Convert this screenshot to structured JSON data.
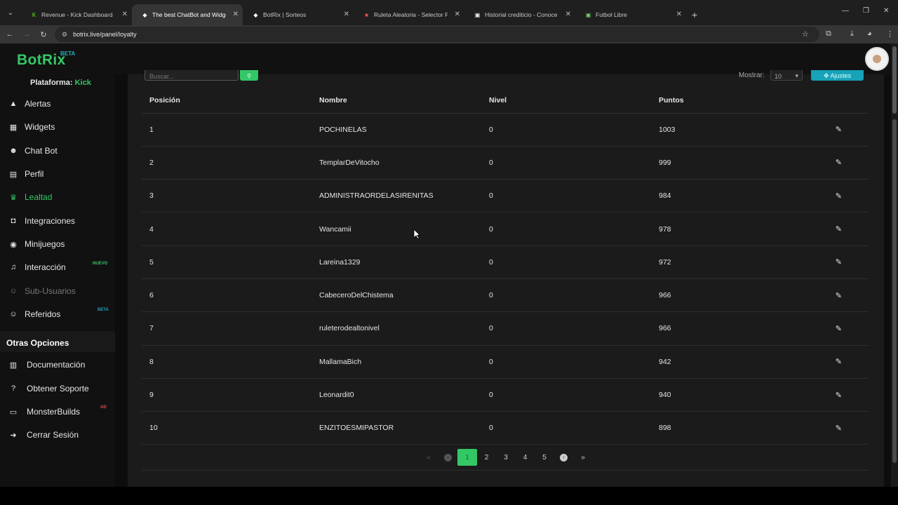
{
  "browser": {
    "tabs": [
      {
        "label": "Revenue - Kick Dashboard",
        "favicon_color": "#53fc18",
        "favicon_glyph": "K"
      },
      {
        "label": "The best ChatBot and Widgets",
        "favicon_color": "#ffffff",
        "favicon_glyph": "◆"
      },
      {
        "label": "BotRix | Sorteos",
        "favicon_color": "#ffffff",
        "favicon_glyph": "◆"
      },
      {
        "label": "Ruleta Aleatoria - Selector Pers",
        "favicon_color": "#e84b4b",
        "favicon_glyph": "■"
      },
      {
        "label": "Historial crediticio - Conoce tu",
        "favicon_color": "#ffffff",
        "favicon_glyph": "▣"
      },
      {
        "label": "Futbol Libre",
        "favicon_color": "#7bd17b",
        "favicon_glyph": "▣"
      }
    ],
    "active_tab_index": 1,
    "url": "botrix.live/panel/loyalty"
  },
  "app": {
    "logo": "BotRix",
    "logo_badge": "BETA",
    "platform_label": "Plataforma:",
    "platform_value": "Kick"
  },
  "sidebar": {
    "items": [
      {
        "label": "Alertas",
        "icon": "warning-icon",
        "glyph": "▲"
      },
      {
        "label": "Widgets",
        "icon": "grid-icon",
        "glyph": "▦"
      },
      {
        "label": "Chat Bot",
        "icon": "robot-icon",
        "glyph": "☻"
      },
      {
        "label": "Perfil",
        "icon": "id-card-icon",
        "glyph": "▤"
      },
      {
        "label": "Lealtad",
        "icon": "trophy-icon",
        "glyph": "♛"
      },
      {
        "label": "Integraciones",
        "icon": "plug-icon",
        "glyph": "◘"
      },
      {
        "label": "Minijuegos",
        "icon": "gamepad-icon",
        "glyph": "◉"
      },
      {
        "label": "Interacción",
        "icon": "music-icon",
        "glyph": "♫"
      },
      {
        "label": "Sub-Usuarios",
        "icon": "users-icon",
        "glyph": "☺"
      },
      {
        "label": "Referidos",
        "icon": "users-icon",
        "glyph": "☺"
      }
    ],
    "badges": {
      "interaccion": "NUEVO",
      "referidos": "BETA",
      "monsterbuilds": "AD"
    },
    "section_title": "Otras Opciones",
    "options": [
      {
        "label": "Documentación",
        "icon": "book-icon",
        "glyph": "▥"
      },
      {
        "label": "Obtener Soporte",
        "icon": "question-icon",
        "glyph": "?"
      },
      {
        "label": "MonsterBuilds",
        "icon": "laptop-icon",
        "glyph": "▭"
      },
      {
        "label": "Cerrar Sesión",
        "icon": "logout-icon",
        "glyph": "➜"
      }
    ]
  },
  "controls": {
    "search_placeholder": "Buscar...",
    "show_label": "Mostrar:",
    "show_value": "10",
    "adjust_label": "✥ Ajustes"
  },
  "table": {
    "headers": [
      "Posición",
      "Nombre",
      "Nivel",
      "Puntos"
    ],
    "rows": [
      [
        "1",
        "POCHINELAS",
        "0",
        "1003"
      ],
      [
        "2",
        "TemplarDeVitocho",
        "0",
        "999"
      ],
      [
        "3",
        "ADMINISTRAORDELASIRENITAS",
        "0",
        "984"
      ],
      [
        "4",
        "Wancamii",
        "0",
        "978"
      ],
      [
        "5",
        "Lareina1329",
        "0",
        "972"
      ],
      [
        "6",
        "CabeceroDelChistema",
        "0",
        "966"
      ],
      [
        "7",
        "ruleterodealtonivel",
        "0",
        "966"
      ],
      [
        "8",
        "MallamaBich",
        "0",
        "942"
      ],
      [
        "9",
        "Leonardit0",
        "0",
        "940"
      ],
      [
        "10",
        "ENZITOESMIPASTOR",
        "0",
        "898"
      ]
    ]
  },
  "pagination": {
    "pages": [
      "1",
      "2",
      "3",
      "4",
      "5"
    ],
    "current": "1"
  },
  "colors": {
    "accent": "#34c766",
    "info": "#17a2b8"
  }
}
